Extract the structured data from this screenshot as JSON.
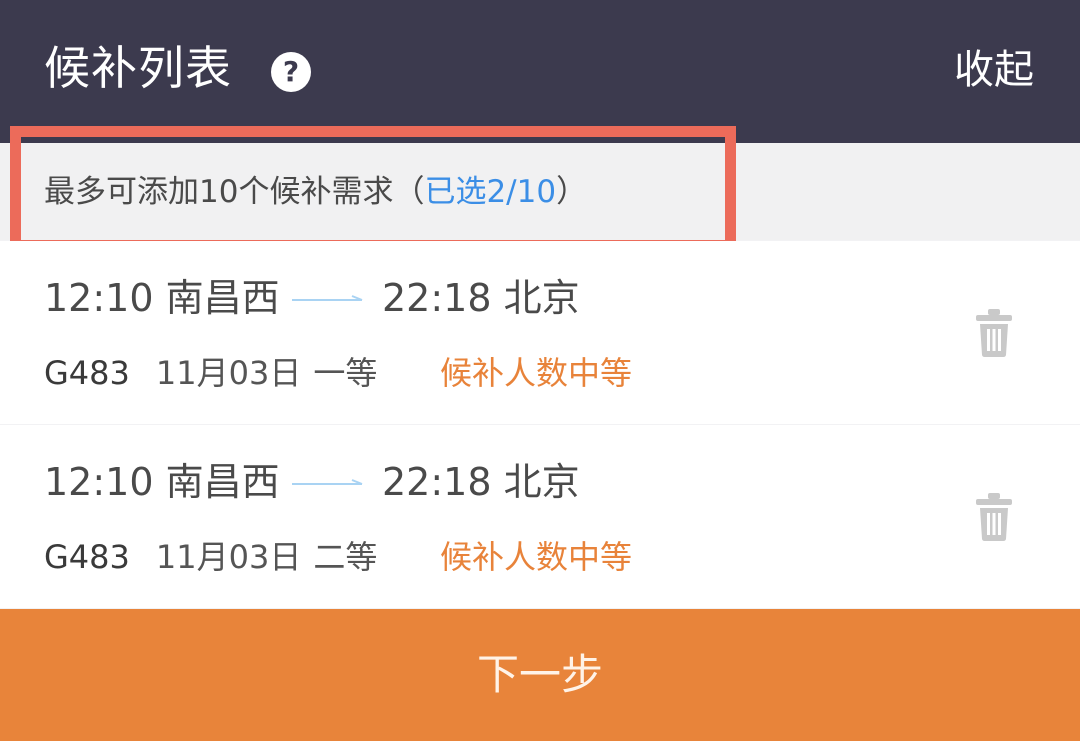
{
  "header": {
    "title": "候补列表",
    "help_icon": "question-icon",
    "collapse_label": "收起"
  },
  "notice": {
    "prefix": "最多可添加10个候补需求（",
    "selected": "已选2/10",
    "suffix": "）"
  },
  "items": [
    {
      "depart_time": "12:10",
      "depart_station": "南昌西",
      "arrive_time": "22:18",
      "arrive_station": "北京",
      "train": "G483",
      "date": "11月03日",
      "seat_class": "一等",
      "status": "候补人数中等"
    },
    {
      "depart_time": "12:10",
      "depart_station": "南昌西",
      "arrive_time": "22:18",
      "arrive_station": "北京",
      "train": "G483",
      "date": "11月03日",
      "seat_class": "二等",
      "status": "候补人数中等"
    }
  ],
  "footer": {
    "next_label": "下一步"
  },
  "colors": {
    "header_bg": "#3c3a4e",
    "accent_orange": "#e8843a",
    "highlight_red": "#ec6b5a",
    "selected_blue": "#3b8ee6"
  }
}
